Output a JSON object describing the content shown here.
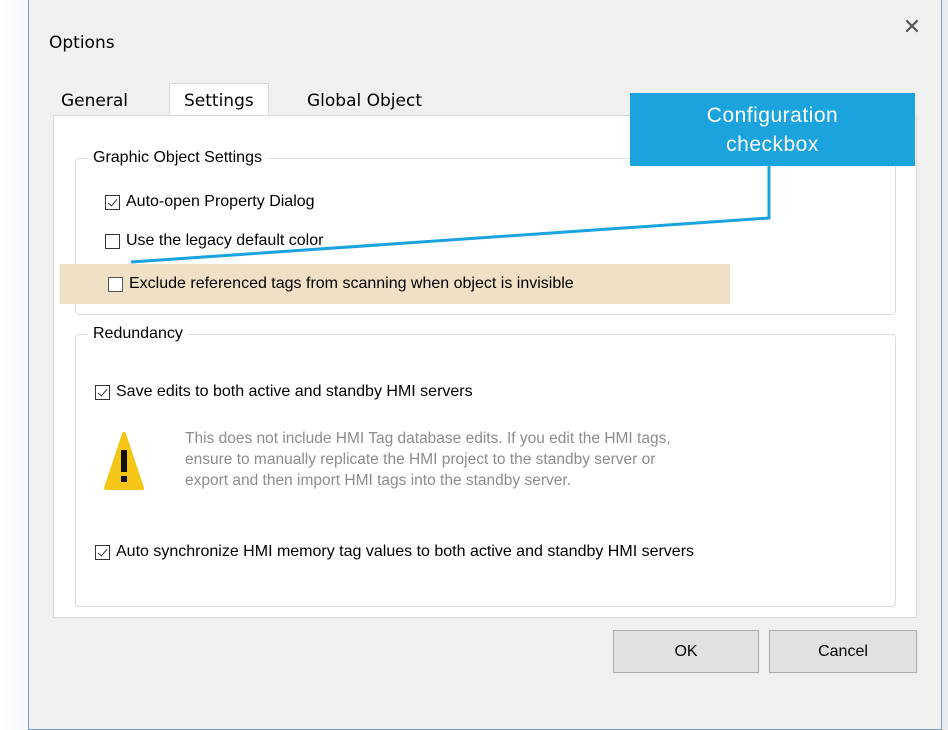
{
  "window": {
    "title": "Options"
  },
  "tabs": [
    {
      "label": "General",
      "active": false
    },
    {
      "label": "Settings",
      "active": true
    },
    {
      "label": "Global Object",
      "active": false
    }
  ],
  "graphic_group": {
    "legend": "Graphic Object Settings",
    "options": [
      {
        "label": "Auto-open Property Dialog",
        "checked": true
      },
      {
        "label": "Use the legacy default color",
        "checked": false
      },
      {
        "label": "Exclude referenced tags from scanning when object is invisible",
        "checked": false,
        "highlighted": true
      }
    ]
  },
  "redundancy_group": {
    "legend": "Redundancy",
    "save_edits": {
      "label": "Save edits to both active and standby HMI servers",
      "checked": true
    },
    "warning_lines": [
      "This does not include HMI Tag database edits. If you edit the HMI tags,",
      "ensure to manually replicate the HMI project to the standby server or",
      "export and then import HMI tags into the standby server."
    ],
    "auto_sync": {
      "label": "Auto synchronize HMI memory tag values to both active and standby HMI servers",
      "checked": true
    }
  },
  "buttons": {
    "ok": "OK",
    "cancel": "Cancel"
  },
  "callout": {
    "line1": "Configuration",
    "line2": "checkbox"
  },
  "colors": {
    "callout_bg": "#1aa3dd",
    "highlight_bg": "#f0e1c6",
    "warning_yellow": "#f5c518"
  },
  "icons": {
    "close": "close-icon",
    "warning": "warning-icon"
  }
}
